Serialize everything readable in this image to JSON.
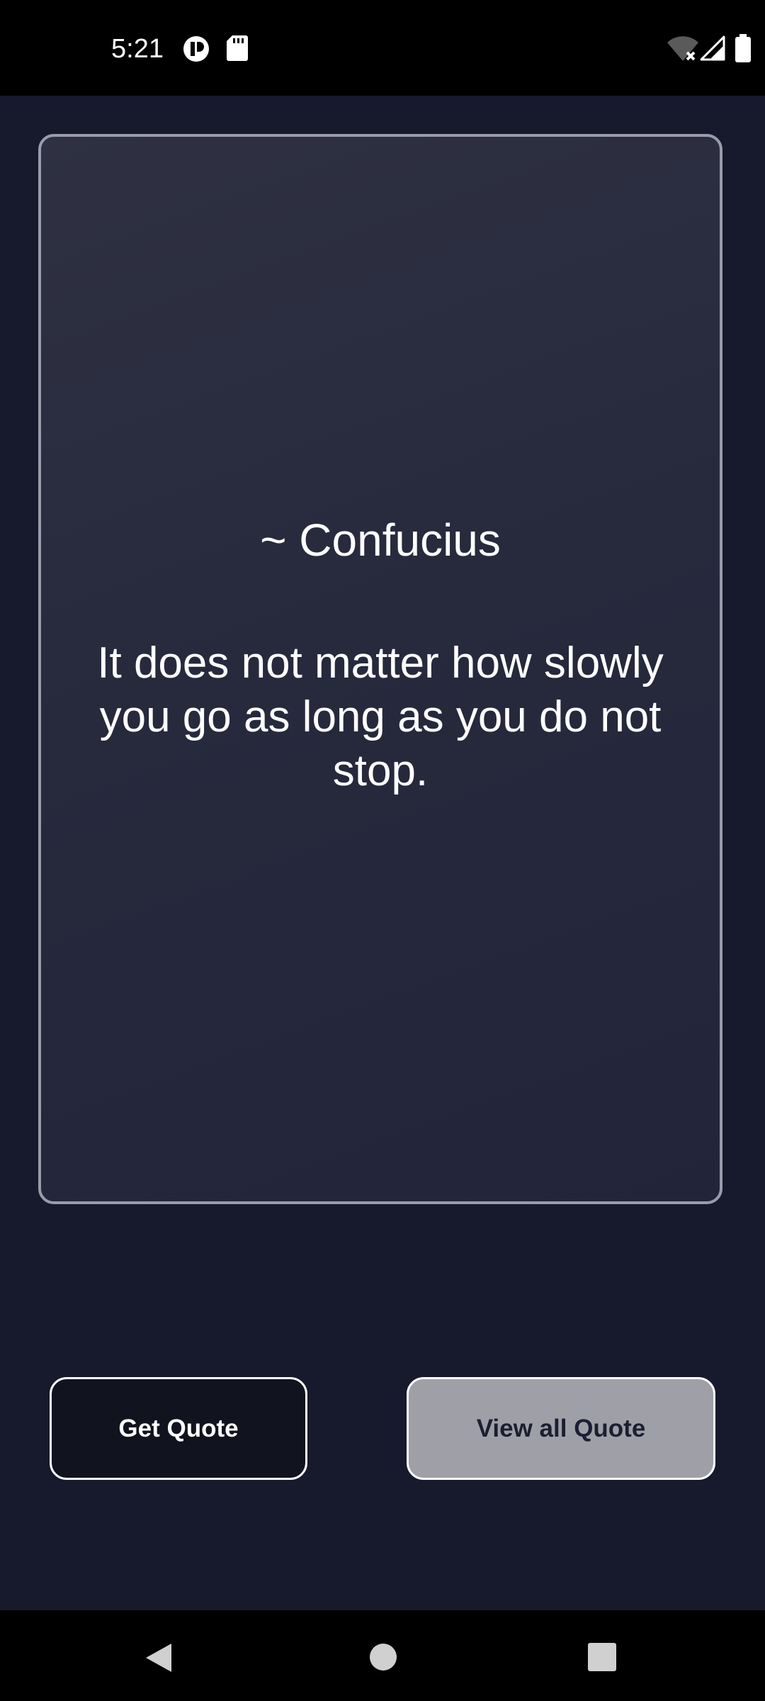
{
  "status_bar": {
    "time": "5:21"
  },
  "quote": {
    "author": "~ Confucius",
    "text": "It does not matter how slowly you go as long as you do not stop."
  },
  "buttons": {
    "get_quote": "Get Quote",
    "view_all": "View all Quote"
  },
  "colors": {
    "background": "#161a2c",
    "card_border": "#9a9cab",
    "get_button_bg": "#11131f",
    "view_button_bg": "#9fa0a7"
  }
}
